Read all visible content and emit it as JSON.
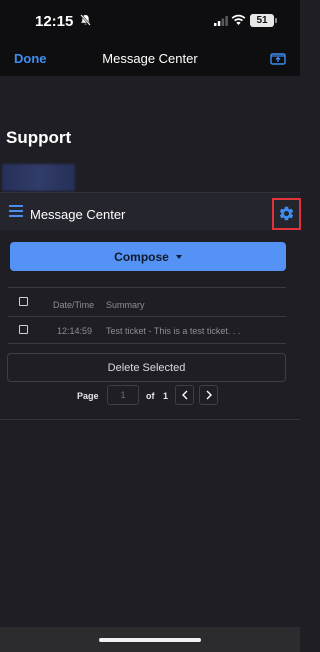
{
  "status_bar": {
    "time": "12:15",
    "battery": "51",
    "icons": [
      "bell-slash-icon",
      "signal-icon",
      "wifi-icon",
      "battery-icon"
    ]
  },
  "nav": {
    "done_label": "Done",
    "title": "Message Center",
    "share_icon": "share-icon"
  },
  "page": {
    "heading": "Support"
  },
  "message_center": {
    "title": "Message Center",
    "menu_icon": "hamburger-icon",
    "settings_icon": "gear-icon",
    "compose_label": "Compose",
    "columns": {
      "date_time": "Date/Time",
      "summary": "Summary"
    },
    "rows": [
      {
        "time": "12:14:59",
        "summary": "Test ticket - This is a test ticket. . ."
      }
    ],
    "delete_label": "Delete Selected",
    "pagination": {
      "page_label": "Page",
      "current_page": "1",
      "of_label": "of",
      "total_pages": "1"
    }
  },
  "colors": {
    "accent": "#3d8ef0",
    "compose_button": "#5592f5",
    "highlight": "#e0343a",
    "background": "#1e1e24"
  }
}
